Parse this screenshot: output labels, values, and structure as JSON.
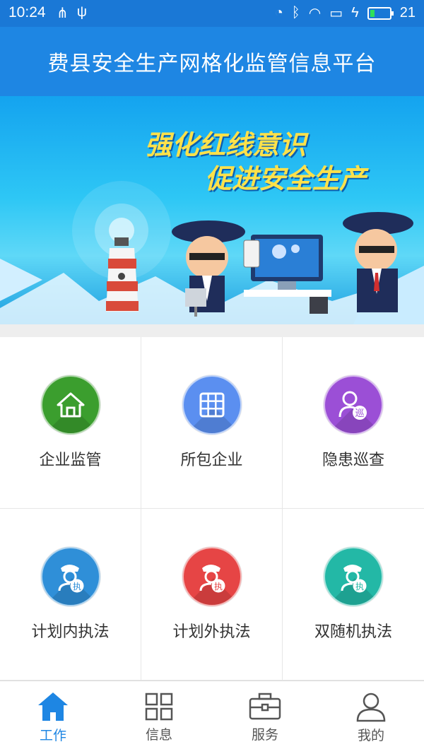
{
  "status_bar": {
    "time": "10:24",
    "battery_level": "21",
    "battery_fraction": 0.21
  },
  "header": {
    "title": "费县安全生产网格化监管信息平台"
  },
  "banner": {
    "line1": "强化红线意识",
    "line2": "促进安全生产"
  },
  "grid": {
    "items": [
      {
        "label": "企业监管",
        "color": "#3b9e2e",
        "icon": "house-icon"
      },
      {
        "label": "所包企业",
        "color": "#5b8ff0",
        "icon": "grid-icon"
      },
      {
        "label": "隐患巡查",
        "color": "#9b4fd6",
        "icon": "patrol-person-icon",
        "badge": "巡"
      },
      {
        "label": "计划内执法",
        "color": "#2f8fd8",
        "icon": "officer-icon",
        "badge": "执"
      },
      {
        "label": "计划外执法",
        "color": "#e64545",
        "icon": "officer-icon",
        "badge": "执"
      },
      {
        "label": "双随机执法",
        "color": "#23b8a6",
        "icon": "officer-icon",
        "badge": "执"
      }
    ]
  },
  "tabbar": {
    "active_color": "#1e86e3",
    "tabs": [
      {
        "label": "工作",
        "icon": "home-icon",
        "active": true
      },
      {
        "label": "信息",
        "icon": "four-squares-icon",
        "active": false
      },
      {
        "label": "服务",
        "icon": "toolbox-icon",
        "active": false
      },
      {
        "label": "我的",
        "icon": "person-icon",
        "active": false
      }
    ]
  }
}
